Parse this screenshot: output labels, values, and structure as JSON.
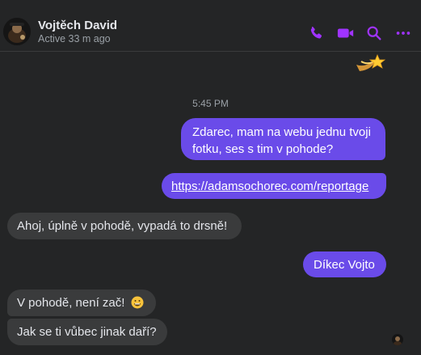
{
  "header": {
    "name": "Vojtěch David",
    "status": "Active 33 m ago",
    "icons": [
      "phone-icon",
      "video-icon",
      "search-icon",
      "more-icon"
    ],
    "accent_color": "#a033ff"
  },
  "chat": {
    "timestamp": "5:45 PM",
    "messages": [
      {
        "from": "me",
        "lines": [
          "Zdarec, mam na webu jednu tvoji",
          "fotku, ses s tim v pohode?"
        ]
      },
      {
        "from": "me",
        "text": "https://adamsochorec.com/reportage"
      },
      {
        "from": "them",
        "text": "Ahoj, úplně v pohodě, vypadá to drsně!"
      },
      {
        "from": "me",
        "text": "Díkec Vojto"
      },
      {
        "from": "them",
        "text": "V pohodě, není zač!",
        "emoji": "grinning-face-icon"
      },
      {
        "from": "them",
        "text": "Jak se ti vůbec jinak daří?"
      }
    ],
    "out_bubble_color": "#6a4be9",
    "in_bubble_color": "#3a3b3c"
  }
}
